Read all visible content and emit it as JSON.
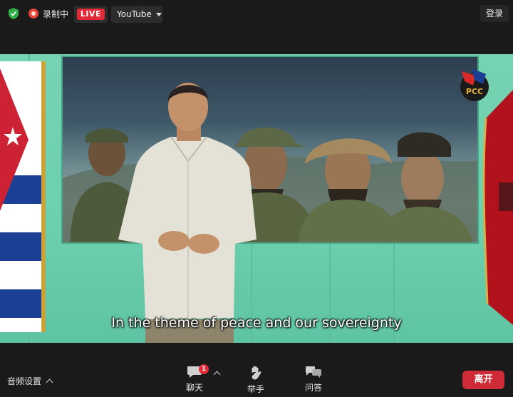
{
  "topbar": {
    "security_icon": "shield-check-icon",
    "recording_label": "录制中",
    "live_label": "LIVE",
    "stream_target": "YouTube",
    "login_label": "登录"
  },
  "video": {
    "subtitle": "In the theme of peace and our sovereignty",
    "logo_text": "PCC"
  },
  "bottombar": {
    "audio_settings_label": "音频设置",
    "chat": {
      "label": "聊天",
      "icon": "chat-bubble-icon",
      "badge": "1"
    },
    "raise_hand": {
      "label": "举手",
      "icon": "hand-icon"
    },
    "qa": {
      "label": "问答",
      "icon": "qa-bubbles-icon"
    },
    "leave_label": "离开"
  },
  "colors": {
    "live_red": "#e02a38",
    "leave_red": "#cf2b36",
    "secure_green": "#2fb14a",
    "background": "#1a1a1a"
  }
}
